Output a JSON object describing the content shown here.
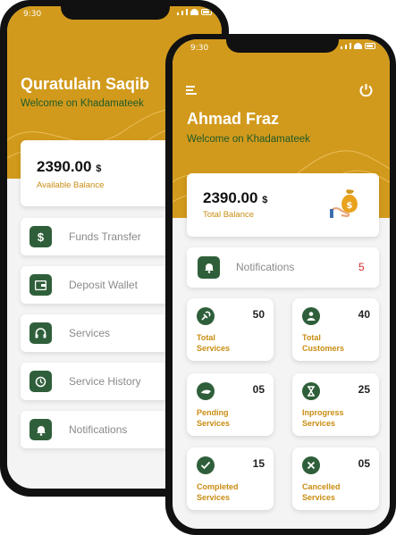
{
  "back_phone": {
    "status_time": "9:30",
    "title": "Quratulain Saqib",
    "subtitle": "Welcome on Khadamateek",
    "balance": {
      "amount": "2390.00",
      "currency": "$",
      "label": "Available Balance"
    },
    "menu": [
      {
        "label": "Funds Transfer",
        "icon": "dollar-icon"
      },
      {
        "label": "Deposit Wallet",
        "icon": "wallet-icon"
      },
      {
        "label": "Services",
        "icon": "headphones-icon"
      },
      {
        "label": "Service History",
        "icon": "history-icon"
      },
      {
        "label": "Notifications",
        "icon": "bell-icon"
      }
    ]
  },
  "front_phone": {
    "status_time": "9:30",
    "title": "Ahmad Fraz",
    "subtitle": "Welcome on Khadamateek",
    "balance": {
      "amount": "2390.00",
      "currency": "$",
      "label": "Total Balance"
    },
    "notifications": {
      "label": "Notifications",
      "count": "5"
    },
    "tiles": [
      {
        "count": "50",
        "line1": "Total",
        "line2": "Services",
        "icon": "services-icon"
      },
      {
        "count": "40",
        "line1": "Total",
        "line2": "Customers",
        "icon": "customers-icon"
      },
      {
        "count": "05",
        "line1": "Pending",
        "line2": "Services",
        "icon": "pending-icon"
      },
      {
        "count": "25",
        "line1": "Inprogress",
        "line2": "Services",
        "icon": "hourglass-icon"
      },
      {
        "count": "15",
        "line1": "Completed",
        "line2": "Services",
        "icon": "check-icon"
      },
      {
        "count": "05",
        "line1": "Cancelled",
        "line2": "Services",
        "icon": "cancel-icon"
      }
    ]
  },
  "colors": {
    "header": "#d29a1c",
    "accent": "#2f5f3a",
    "label_gold": "#c98d12",
    "badge_red": "#d42a2a"
  }
}
